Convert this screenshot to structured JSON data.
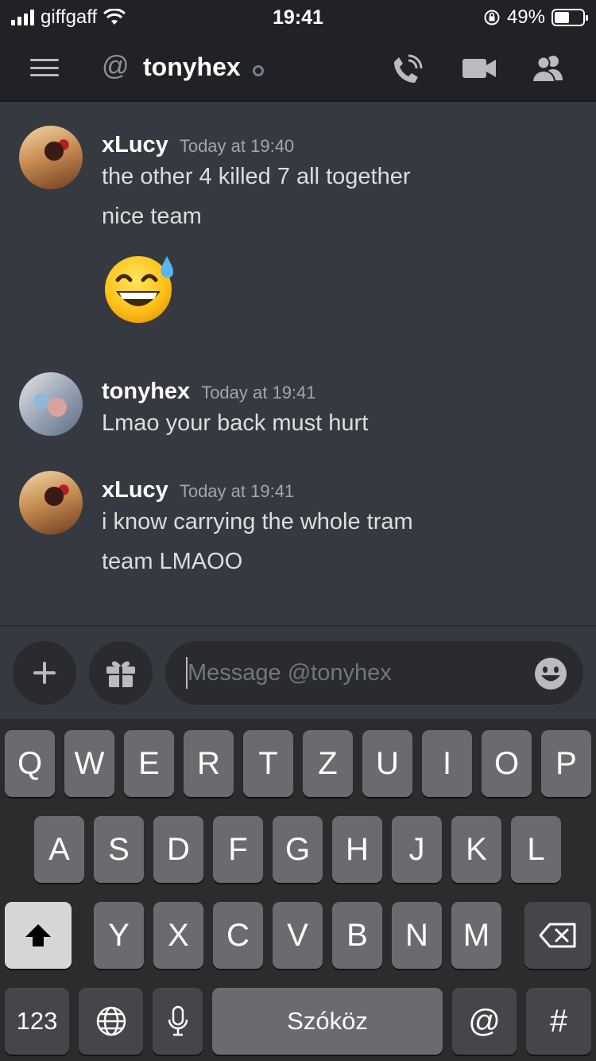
{
  "status_bar": {
    "carrier": "giffgaff",
    "time": "19:41",
    "battery": "49%"
  },
  "header": {
    "title": "tonyhex",
    "at_symbol": "@"
  },
  "messages": [
    {
      "author": "xLucy",
      "timestamp": "Today at 19:40",
      "lines": [
        "the other 4 killed 7 all together",
        "nice team"
      ],
      "emoji": "grinning-face-with-sweat"
    },
    {
      "author": "tonyhex",
      "timestamp": "Today at 19:41",
      "lines": [
        "Lmao your back must hurt"
      ]
    },
    {
      "author": "xLucy",
      "timestamp": "Today at 19:41",
      "lines": [
        "i know carrying the whole tram",
        "team LMAOO"
      ]
    }
  ],
  "composer": {
    "placeholder": "Message @tonyhex"
  },
  "keyboard": {
    "row1": [
      "Q",
      "W",
      "E",
      "R",
      "T",
      "Z",
      "U",
      "I",
      "O",
      "P"
    ],
    "row2": [
      "A",
      "S",
      "D",
      "F",
      "G",
      "H",
      "J",
      "K",
      "L"
    ],
    "row3": [
      "Y",
      "X",
      "C",
      "V",
      "B",
      "N",
      "M"
    ],
    "numbers_label": "123",
    "space_label": "Szóköz",
    "at_label": "@",
    "hash_label": "#"
  },
  "colors": {
    "background": "#36393f",
    "header": "#202225",
    "accent": "#7289da"
  }
}
